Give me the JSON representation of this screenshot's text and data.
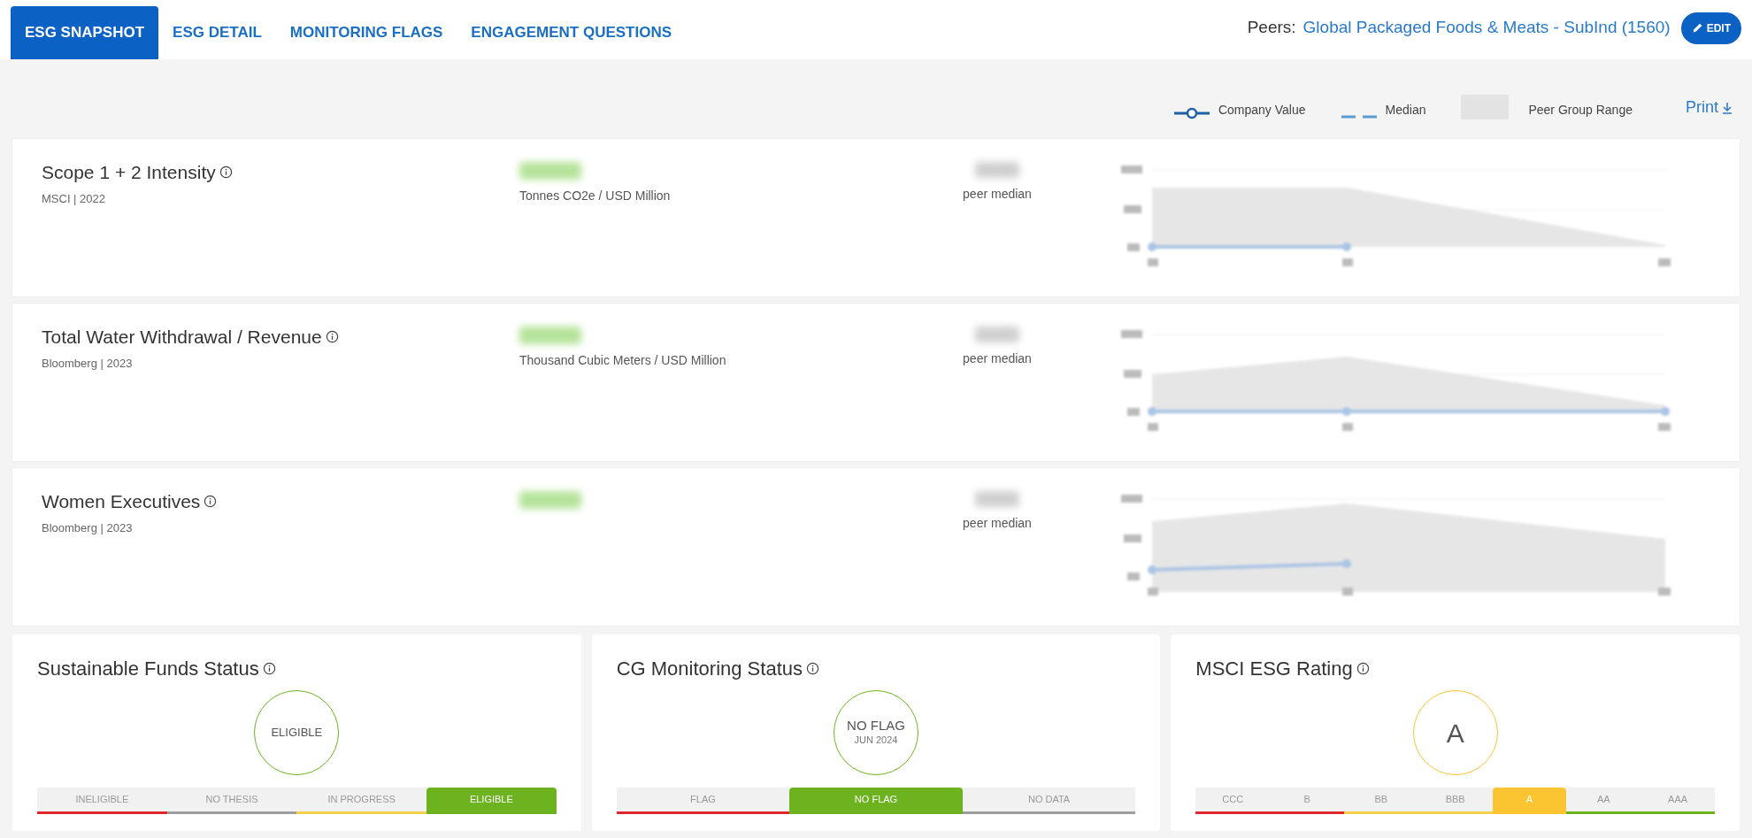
{
  "tabs": [
    {
      "label": "ESG SNAPSHOT",
      "selected": true
    },
    {
      "label": "ESG DETAIL",
      "selected": false
    },
    {
      "label": "MONITORING FLAGS",
      "selected": false
    },
    {
      "label": "ENGAGEMENT QUESTIONS",
      "selected": false
    }
  ],
  "peers": {
    "label": "Peers:",
    "value": "Global Packaged Foods & Meats - SubInd (1560)",
    "edit_button": "EDIT"
  },
  "legend": {
    "company_value": "Company Value",
    "median": "Median",
    "peer_group_range": "Peer Group Range",
    "print": "Print"
  },
  "metrics": [
    {
      "title": "Scope 1 + 2 Intensity",
      "source": "MSCI | 2022",
      "unit": "Tonnes CO2e / USD Million",
      "median_label": "peer median"
    },
    {
      "title": "Total Water Withdrawal / Revenue",
      "source": "Bloomberg | 2023",
      "unit": "Thousand Cubic Meters / USD Million",
      "median_label": "peer median"
    },
    {
      "title": "Women Executives",
      "source": "Bloomberg | 2023",
      "median_label": "peer median"
    }
  ],
  "status_cards": [
    {
      "title": "Sustainable Funds Status",
      "status": "ELIGIBLE",
      "segments": [
        {
          "label": "INELIGIBLE",
          "color": "#e0262f",
          "selected": false
        },
        {
          "label": "NO THESIS",
          "color": "#9e9e9e",
          "selected": false
        },
        {
          "label": "IN PROGRESS",
          "color": "#f5d04a",
          "selected": false
        },
        {
          "label": "ELIGIBLE",
          "color": "#6cb31f",
          "selected": true
        }
      ]
    },
    {
      "title": "CG Monitoring Status",
      "status": "NO FLAG",
      "date": "JUN 2024",
      "segments": [
        {
          "label": "FLAG",
          "color": "#e0262f",
          "selected": false
        },
        {
          "label": "NO FLAG",
          "color": "#6cb31f",
          "selected": true
        },
        {
          "label": "NO DATA",
          "color": "#9e9e9e",
          "selected": false
        }
      ]
    },
    {
      "title": "MSCI ESG Rating",
      "status": "A",
      "kind": "rating",
      "segments": [
        {
          "label": "CCC",
          "color": "#e0262f",
          "selected": false
        },
        {
          "label": "B",
          "color": "#e0262f",
          "selected": false
        },
        {
          "label": "BB",
          "color": "#f5d04a",
          "selected": false
        },
        {
          "label": "BBB",
          "color": "#f5d04a",
          "selected": false
        },
        {
          "label": "A",
          "color": "#fbc531",
          "selected": true
        },
        {
          "label": "AA",
          "color": "#6cb31f",
          "selected": false
        },
        {
          "label": "AAA",
          "color": "#6cb31f",
          "selected": false
        }
      ]
    }
  ]
}
